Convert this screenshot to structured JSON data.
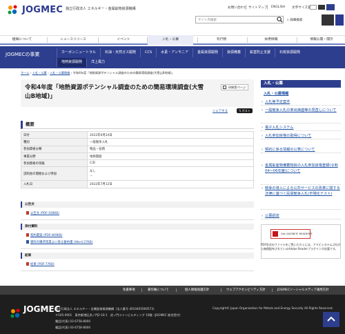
{
  "header": {
    "logo_text": "JOGMEC",
    "org_name": "独立行政法人 エネルギー・金属鉱物資源機構",
    "top_links": [
      "お問い合わせ",
      "サイトマップ",
      "ENGLISH",
      "文字サイズ変更"
    ],
    "search_placeholder": "サイト内検索",
    "advanced_search": "詳細検索"
  },
  "gnav": [
    "組織について",
    "ニュースリリース",
    "イベント",
    "入札・公募",
    "刊行物",
    "採用情報",
    "情報公開・開示"
  ],
  "subnav": {
    "title": "JOGMECの事業",
    "row1": [
      "カーボンニュートラル",
      "石油・天然ガス開発",
      "CCS",
      "水素・アンモニア",
      "金属資源開発",
      "資源備蓄",
      "鉱害防止支援",
      "石炭資源開発"
    ],
    "row2": [
      "地熱資源開発",
      "洋上風力"
    ]
  },
  "breadcrumb": [
    "ホーム",
    "入札・公募",
    "入札・公募情報",
    "令和4年度「地熱資源ポテンシャル調査のための簡易環境調査(大雪山B地域)」"
  ],
  "main": {
    "title": "令和4年度「地熱資源ポテンシャル調査のための簡易環境調査(大雪山B地域)」",
    "print_label": "印刷用ページ",
    "share_label": "シェアする",
    "tweet_label": "ポスト",
    "overview_heading": "概要",
    "table": [
      {
        "k": "日付",
        "v": "2022年6月24日"
      },
      {
        "k": "種別",
        "v": "一般競争入札"
      },
      {
        "k": "参加資格分類",
        "v": "物品・役務"
      },
      {
        "k": "事業分野",
        "v": "地熱開発"
      },
      {
        "k": "参加資格の等級",
        "v": "C/D"
      },
      {
        "k": "説明会の開催および参加",
        "v": "なし\n－"
      },
      {
        "k": "入札日",
        "v": "2022年7月12日"
      }
    ],
    "notice_heading": "公告文",
    "notice_files": [
      "公告文 (PDF:108KB)"
    ],
    "attach_heading": "添付資料",
    "attach_files": [
      "契約書案 (PDF:469KB)",
      "資料の購済等業よに係る誓約書 (Word:27KB)"
    ],
    "result_heading": "結果",
    "result_files": [
      "結果 (PDF:77KB)"
    ]
  },
  "sidebar": {
    "head": "入札・公募",
    "sub": "入札・公募情報",
    "links": [
      "入札等予定案件",
      "一般競争入札の単出価連等の見直しについて",
      "電子入札システム",
      "入札参加資格の取得について",
      "契約に係る情報の公表について",
      "金属鉱産物備蓄物資の入札参加資格登録(令和04〜06年度)について",
      "競争の導入による公共サービスの改革に関する法律に基づく民間競争入札(市場化テスト)"
    ],
    "extra_link": "公募調達",
    "adobe_label": "Get ADOBE® READER®",
    "adobe_note": "PDF形式のファイルをご覧いただくには、アドビシステムズ社から無償配布されているAdobe Readerプラグインが必要です。"
  },
  "footer": {
    "nav": [
      "免責事項",
      "著作権について",
      "個人情報保護方針",
      "ウェブアクセシビリティ方針",
      "JOGMECソーシャルメディア運用方針"
    ],
    "logo_text": "JOGMEC",
    "address_lines": [
      "独立行政法人 エネルギー・金属鉱物資源機構（法人番号 4010405000573）",
      "〒105-0001　東京都港区虎ノ門2-10-1　虎ノ門ツインビルディング 10階（JOGMEC 総合受付）",
      "電話(代表) 03-6758-8000",
      "電話(代表) 03-6758-8000"
    ],
    "copyright": "Copyright© Japan Organization for Metals and Energy Security All Rights Reserved."
  },
  "colors": {
    "brand": "#2e3e8e",
    "link": "#1a4ea0",
    "footer_dark": "#1e1e1e"
  }
}
